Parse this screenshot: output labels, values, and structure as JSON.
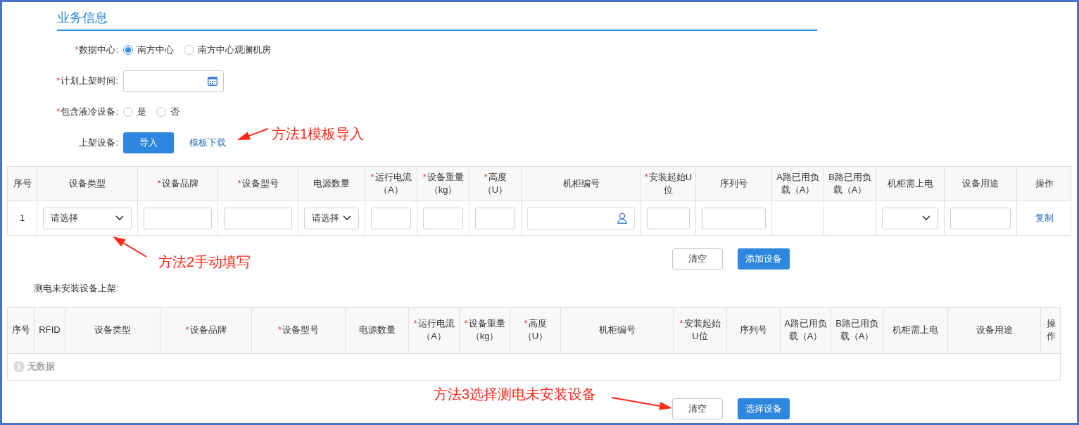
{
  "section_title": "业务信息",
  "required_mark": "*",
  "form": [
    {
      "kind": "radio",
      "label": "数据中心:",
      "required": true,
      "options": [
        {
          "label": "南方中心",
          "selected": true
        },
        {
          "label": "南方中心观澜机房",
          "selected": false
        }
      ]
    },
    {
      "kind": "date",
      "label": "计划上架时间:",
      "required": true
    },
    {
      "kind": "radio",
      "label": "包含液冷设备:",
      "required": true,
      "options": [
        {
          "label": "是",
          "selected": false
        },
        {
          "label": "否",
          "selected": false
        }
      ]
    },
    {
      "kind": "upload",
      "label": "上架设备:",
      "required": false,
      "button": "导入",
      "link": "模板下载"
    }
  ],
  "device_table": {
    "columns": [
      {
        "label": "序号",
        "required": false
      },
      {
        "label": "设备类型",
        "required": false
      },
      {
        "label": "设备品牌",
        "required": true
      },
      {
        "label": "设备型号",
        "required": true
      },
      {
        "label": "电源数量",
        "required": false
      },
      {
        "label": "运行电流（A）",
        "required": true
      },
      {
        "label": "设备重量（kg）",
        "required": true
      },
      {
        "label": "高度（U）",
        "required": true
      },
      {
        "label": "机柜编号",
        "required": false
      },
      {
        "label": "安装起始U位",
        "required": true
      },
      {
        "label": "序列号",
        "required": false
      },
      {
        "label": "A路已用负载（A）",
        "required": false
      },
      {
        "label": "B路已用负载（A）",
        "required": false
      },
      {
        "label": "机柜需上电",
        "required": false
      },
      {
        "label": "设备用途",
        "required": false
      },
      {
        "label": "操作",
        "required": false
      }
    ],
    "rows": [
      [
        {
          "kind": "text",
          "text": "1"
        },
        {
          "kind": "select",
          "text": "请选择"
        },
        {
          "kind": "input"
        },
        {
          "kind": "input"
        },
        {
          "kind": "select",
          "text": "请选择"
        },
        {
          "kind": "input"
        },
        {
          "kind": "input"
        },
        {
          "kind": "input"
        },
        {
          "kind": "user"
        },
        {
          "kind": "input"
        },
        {
          "kind": "input"
        },
        {
          "kind": "empty"
        },
        {
          "kind": "empty"
        },
        {
          "kind": "select"
        },
        {
          "kind": "input"
        },
        {
          "kind": "link",
          "text": "复制"
        }
      ]
    ],
    "buttons": [
      {
        "label": "清空",
        "primary": false
      },
      {
        "label": "添加设备",
        "primary": true
      }
    ]
  },
  "untested_label": "测电未安装设备上架:",
  "untested_table": {
    "columns": [
      {
        "label": "序号",
        "required": false
      },
      {
        "label": "RFID",
        "required": false
      },
      {
        "label": "设备类型",
        "required": false
      },
      {
        "label": "设备品牌",
        "required": true
      },
      {
        "label": "设备型号",
        "required": true
      },
      {
        "label": "电源数量",
        "required": false
      },
      {
        "label": "运行电流（A）",
        "required": true
      },
      {
        "label": "设备重量（kg）",
        "required": true
      },
      {
        "label": "高度（U）",
        "required": true
      },
      {
        "label": "机柜编号",
        "required": false
      },
      {
        "label": "安装起始U位",
        "required": true
      },
      {
        "label": "序列号",
        "required": false
      },
      {
        "label": "A路已用负载（A）",
        "required": false
      },
      {
        "label": "B路已用负载（A）",
        "required": false
      },
      {
        "label": "机柜需上电",
        "required": false
      },
      {
        "label": "设备用途",
        "required": false
      },
      {
        "label": "操作",
        "required": false
      }
    ],
    "empty_text": "无数据",
    "buttons": [
      {
        "label": "清空",
        "primary": false
      },
      {
        "label": "选择设备",
        "primary": true
      }
    ]
  },
  "annotations": [
    {
      "text": "方法1模板导入"
    },
    {
      "text": "方法2手动填写"
    },
    {
      "text": "方法3选择测电未安装设备"
    }
  ]
}
